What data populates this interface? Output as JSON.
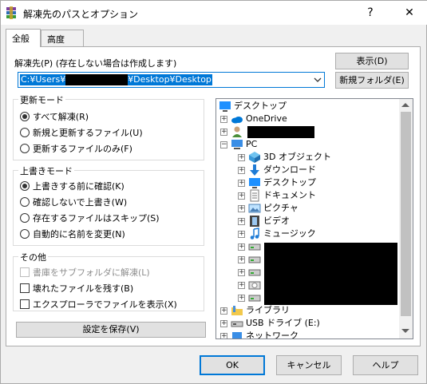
{
  "window": {
    "title": "解凍先のパスとオプション",
    "help_glyph": "?",
    "close_glyph": "✕"
  },
  "tabs": [
    {
      "label": "全般",
      "active": true
    },
    {
      "label": "高度",
      "active": false
    }
  ],
  "dest": {
    "label": "解凍先(P) (存在しない場合は作成します)",
    "path_prefix": "C:¥Users¥",
    "path_suffix": "¥Desktop¥Desktop"
  },
  "buttons": {
    "show": "表示(D)",
    "new_folder": "新規フォルダ(E)",
    "save_settings": "設定を保存(V)",
    "ok": "OK",
    "cancel": "キャンセル",
    "help": "ヘルプ"
  },
  "update_mode": {
    "title": "更新モード",
    "options": [
      {
        "label": "すべて解凍(R)",
        "checked": true
      },
      {
        "label": "新規と更新するファイル(U)",
        "checked": false
      },
      {
        "label": "更新するファイルのみ(F)",
        "checked": false
      }
    ]
  },
  "overwrite_mode": {
    "title": "上書きモード",
    "options": [
      {
        "label": "上書きする前に確認(K)",
        "checked": true
      },
      {
        "label": "確認しないで上書き(W)",
        "checked": false
      },
      {
        "label": "存在するファイルはスキップ(S)",
        "checked": false
      },
      {
        "label": "自動的に名前を変更(N)",
        "checked": false
      }
    ]
  },
  "other": {
    "title": "その他",
    "options": [
      {
        "label": "書庫をサブフォルダに解凍(L)",
        "checked": false,
        "disabled": true
      },
      {
        "label": "壊れたファイルを残す(B)",
        "checked": false,
        "disabled": false
      },
      {
        "label": "エクスプローラでファイルを表示(X)",
        "checked": false,
        "disabled": false
      }
    ]
  },
  "tree": {
    "desktop": "デスクトップ",
    "onedrive": "OneDrive",
    "pc": "PC",
    "pc_items": [
      "3D オブジェクト",
      "ダウンロード",
      "デスクトップ",
      "ドキュメント",
      "ピクチャ",
      "ビデオ",
      "ミュージック"
    ],
    "libraries": "ライブラリ",
    "usb": "USB ドライブ (E:)",
    "network": "ネットワーク",
    "expander_plus": "+",
    "expander_minus": "−"
  },
  "colors": {
    "accent": "#0078d7",
    "panel": "#f0f0f0",
    "button_face": "#e1e1e1"
  }
}
